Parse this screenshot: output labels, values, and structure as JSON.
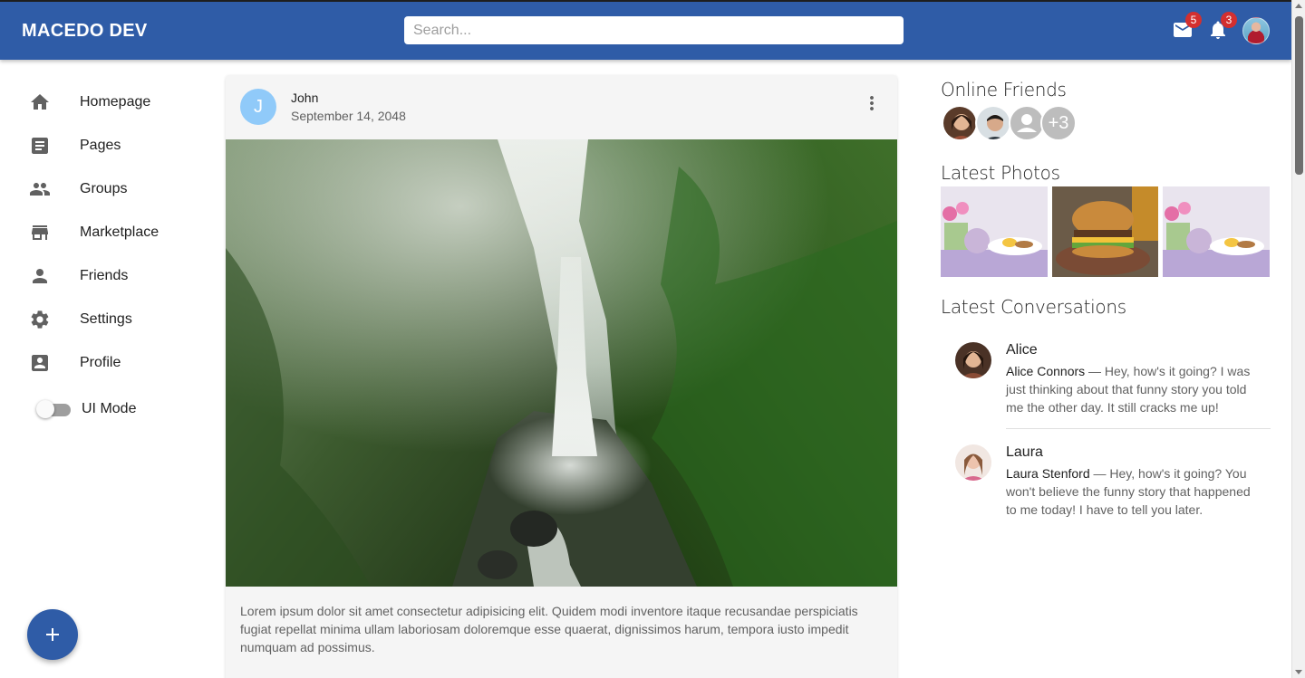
{
  "appbar": {
    "brand": "MACEDO DEV",
    "search_placeholder": "Search...",
    "mail_badge": "5",
    "notifications_badge": "3"
  },
  "sidebar": {
    "items": [
      {
        "label": "Homepage",
        "icon": "home-icon"
      },
      {
        "label": "Pages",
        "icon": "article-icon"
      },
      {
        "label": "Groups",
        "icon": "groups-icon"
      },
      {
        "label": "Marketplace",
        "icon": "storefront-icon"
      },
      {
        "label": "Friends",
        "icon": "person-icon"
      },
      {
        "label": "Settings",
        "icon": "settings-icon"
      },
      {
        "label": "Profile",
        "icon": "account-box-icon"
      }
    ],
    "ui_mode_label": "UI Mode",
    "ui_mode_on": false
  },
  "post": {
    "avatar_letter": "J",
    "author": "John",
    "date": "September 14, 2048",
    "text": "Lorem ipsum dolor sit amet consectetur adipisicing elit. Quidem modi inventore itaque recusandae perspiciatis fugiat repellat minima ullam laboriosam doloremque esse quaerat, dignissimos harum, tempora iusto impedit numquam ad possimus."
  },
  "right": {
    "online_friends_title": "Online Friends",
    "online_more": "+3",
    "latest_photos_title": "Latest Photos",
    "latest_conversations_title": "Latest Conversations",
    "conversations": [
      {
        "name": "Alice",
        "sender": "Alice Connors",
        "message": " — Hey, how's it going? I was just thinking about that funny story you told me the other day. It still cracks me up!"
      },
      {
        "name": "Laura",
        "sender": "Laura Stenford",
        "message": " — Hey, how's it going? You won't believe the funny story that happened to me today! I have to tell you later."
      }
    ]
  },
  "colors": {
    "primary": "#2f5ca7",
    "badge": "#d32f2f",
    "post_avatar": "#90caf9"
  }
}
